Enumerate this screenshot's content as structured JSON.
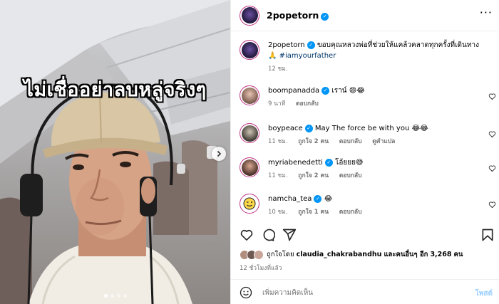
{
  "media": {
    "caption": "ไม่เชื่ออย่าลบหลู่จริงๆ",
    "slide_count": 4,
    "active_slide": 1
  },
  "post": {
    "username": "2popetorn",
    "caption_text": "ขอบคุณหลวงพ่อที่ช่วยให้แคล้วคลาดทุกครั้งที่เดินทาง",
    "caption_emoji": "🙏",
    "hashtag": "#iamyourfather",
    "time": "12 ชม."
  },
  "comments": [
    {
      "username": "boompanadda",
      "verified": true,
      "text": "เราน์ 😄😂",
      "time": "9 นาที",
      "likes": "",
      "actions": [
        "ตอบกลับ"
      ]
    },
    {
      "username": "boypeace",
      "verified": true,
      "text": "May The force be with you 😂😂",
      "time": "11 ชม.",
      "likes": "ถูกใจ 2 คน",
      "actions": [
        "ตอบกลับ",
        "ดูคำแปล"
      ]
    },
    {
      "username": "myriabenedetti",
      "verified": true,
      "text": "โอ้ยยย😅",
      "time": "11 ชม.",
      "likes": "ถูกใจ 2 คน",
      "actions": [
        "ตอบกลับ"
      ]
    },
    {
      "username": "namcha_tea",
      "verified": true,
      "text": "😂",
      "time": "10 ชม.",
      "likes": "ถูกใจ 1 คน",
      "actions": [
        "ตอบกลับ"
      ]
    }
  ],
  "likes": {
    "prefix": "ถูกใจโดย",
    "user": "claudia_chakrabandhu",
    "middle": "และคนอื่นๆ อีก",
    "count": "3,268",
    "suffix": "คน"
  },
  "posted_ago": "12 ชั่วโมงที่แล้ว",
  "composer": {
    "placeholder": "เพิ่มความคิดเห็น",
    "post_label": "โพสต์"
  },
  "colors": {
    "accent": "#0095f6",
    "hashtag": "#00376b",
    "muted": "#737373",
    "post_disabled": "#9bcfff"
  },
  "icons": [
    "more-icon",
    "heart-icon",
    "comment-icon",
    "share-icon",
    "bookmark-icon",
    "emoji-icon",
    "chevron-right-icon",
    "verified-icon"
  ]
}
